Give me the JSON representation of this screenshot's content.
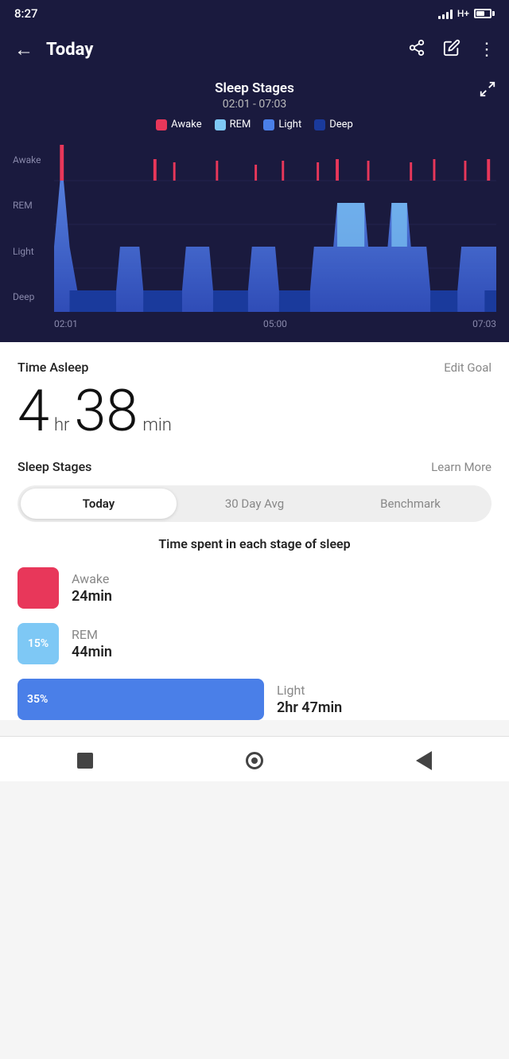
{
  "statusBar": {
    "time": "8:27",
    "signal": "H+",
    "batteryPercent": 65
  },
  "header": {
    "title": "Today",
    "backLabel": "←",
    "shareLabel": "share",
    "editLabel": "edit",
    "moreLabel": "more"
  },
  "chart": {
    "title": "Sleep Stages",
    "timeRange": "02:01 - 07:03",
    "legend": [
      {
        "label": "Awake",
        "color": "#e8375a"
      },
      {
        "label": "REM",
        "color": "#7ec8f5"
      },
      {
        "label": "Light",
        "color": "#4a7fe8"
      },
      {
        "label": "Deep",
        "color": "#1a3a9c"
      }
    ],
    "yLabels": [
      "Awake",
      "REM",
      "Light",
      "Deep"
    ],
    "xLabels": [
      "02:01",
      "05:00",
      "07:03"
    ]
  },
  "timeAsleep": {
    "label": "Time Asleep",
    "editGoalLabel": "Edit Goal",
    "hours": "4",
    "hrUnit": "hr",
    "minutes": "38",
    "minUnit": "min"
  },
  "sleepStages": {
    "label": "Sleep Stages",
    "learnMoreLabel": "Learn More",
    "tabs": [
      {
        "label": "Today",
        "active": true
      },
      {
        "label": "30 Day Avg",
        "active": false
      },
      {
        "label": "Benchmark",
        "active": false
      }
    ],
    "subLabel": "Time spent in each stage of sleep",
    "stages": [
      {
        "name": "Awake",
        "time": "24min",
        "color": "#e8375a",
        "percent": null,
        "wide": false
      },
      {
        "name": "REM",
        "time": "44min",
        "color": "#7ec8f5",
        "percent": "15%",
        "wide": false
      },
      {
        "name": "Light",
        "time": "2hr 47min",
        "color": "#4a7fe8",
        "percent": "35%",
        "wide": true
      }
    ]
  },
  "bottomNav": {
    "square": "stop-icon",
    "circle": "home-icon",
    "triangle": "back-icon"
  }
}
